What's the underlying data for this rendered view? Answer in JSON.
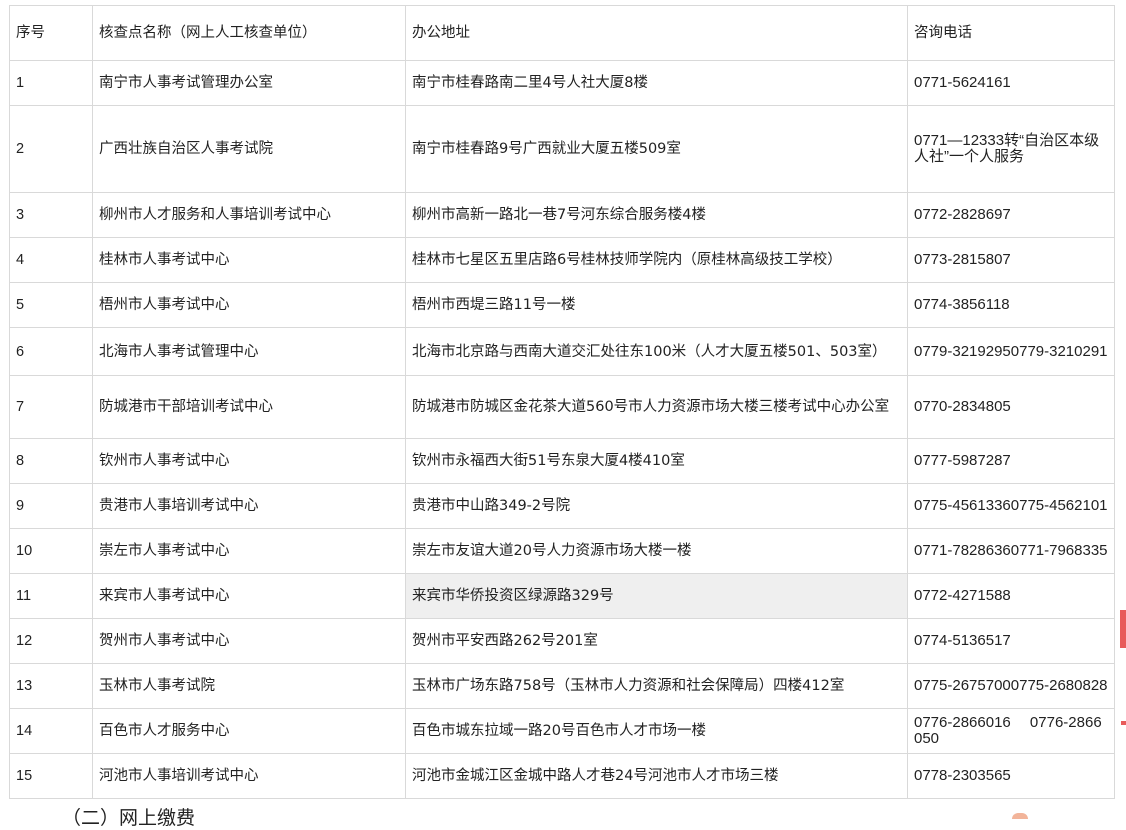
{
  "table": {
    "headers": [
      "序号",
      "核查点名称（网上人工核查单位）",
      "办公地址",
      "咨询电话"
    ],
    "rows": [
      {
        "no": "1",
        "name": "南宁市人事考试管理办公室",
        "address": "南宁市桂春路南二里4号人社大厦8楼",
        "phone": "0771-5624161"
      },
      {
        "no": "2",
        "name": "广西壮族自治区人事考试院",
        "address": "南宁市桂春路9号广西就业大厦五楼509室",
        "phone": "0771—12333转“自治区本级人社”一个人服务"
      },
      {
        "no": "3",
        "name": "柳州市人才服务和人事培训考试中心",
        "address": "柳州市高新一路北一巷7号河东综合服务楼4楼",
        "phone": "0772-2828697"
      },
      {
        "no": "4",
        "name": "桂林市人事考试中心",
        "address": "桂林市七星区五里店路6号桂林技师学院内（原桂林高级技工学校）",
        "phone": "0773-2815807"
      },
      {
        "no": "5",
        "name": "梧州市人事考试中心",
        "address": "梧州市西堤三路11号一楼",
        "phone": "0774-3856118"
      },
      {
        "no": "6",
        "name": "北海市人事考试管理中心",
        "address": "北海市北京路与西南大道交汇处往东100米（人才大厦五楼501、503室）",
        "phone": "0779-32192950779-3210291"
      },
      {
        "no": "7",
        "name": "防城港市干部培训考试中心",
        "address": "防城港市防城区金花茶大道560号市人力资源市场大楼三楼考试中心办公室",
        "phone": "0770-2834805"
      },
      {
        "no": "8",
        "name": "钦州市人事考试中心",
        "address": "钦州市永福西大街51号东泉大厦4楼410室",
        "phone": "0777-5987287"
      },
      {
        "no": "9",
        "name": "贵港市人事培训考试中心",
        "address": "贵港市中山路349-2号院",
        "phone": "0775-45613360775-4562101"
      },
      {
        "no": "10",
        "name": "崇左市人事考试中心",
        "address": "崇左市友谊大道20号人力资源市场大楼一楼",
        "phone": "0771-78286360771-7968335"
      },
      {
        "no": "11",
        "name": "来宾市人事考试中心",
        "address": "来宾市华侨投资区绿源路329号",
        "phone": "0772-4271588"
      },
      {
        "no": "12",
        "name": "贺州市人事考试中心",
        "address": "贺州市平安西路262号201室",
        "phone": "0774-5136517"
      },
      {
        "no": "13",
        "name": "玉林市人事考试院",
        "address": "玉林市广场东路758号（玉林市人力资源和社会保障局）四楼412室",
        "phone": "0775-26757000775-2680828"
      },
      {
        "no": "14",
        "name": "百色市人才服务中心",
        "address": "百色市城东拉域一路20号百色市人才市场一楼",
        "phone": "0776-2866016　 0776-2866050"
      },
      {
        "no": "15",
        "name": "河池市人事培训考试中心",
        "address": "河池市金城江区金城中路人才巷24号河池市人才市场三楼",
        "phone": "0778-2303565"
      }
    ]
  },
  "section_heading": "（二）网上缴费"
}
